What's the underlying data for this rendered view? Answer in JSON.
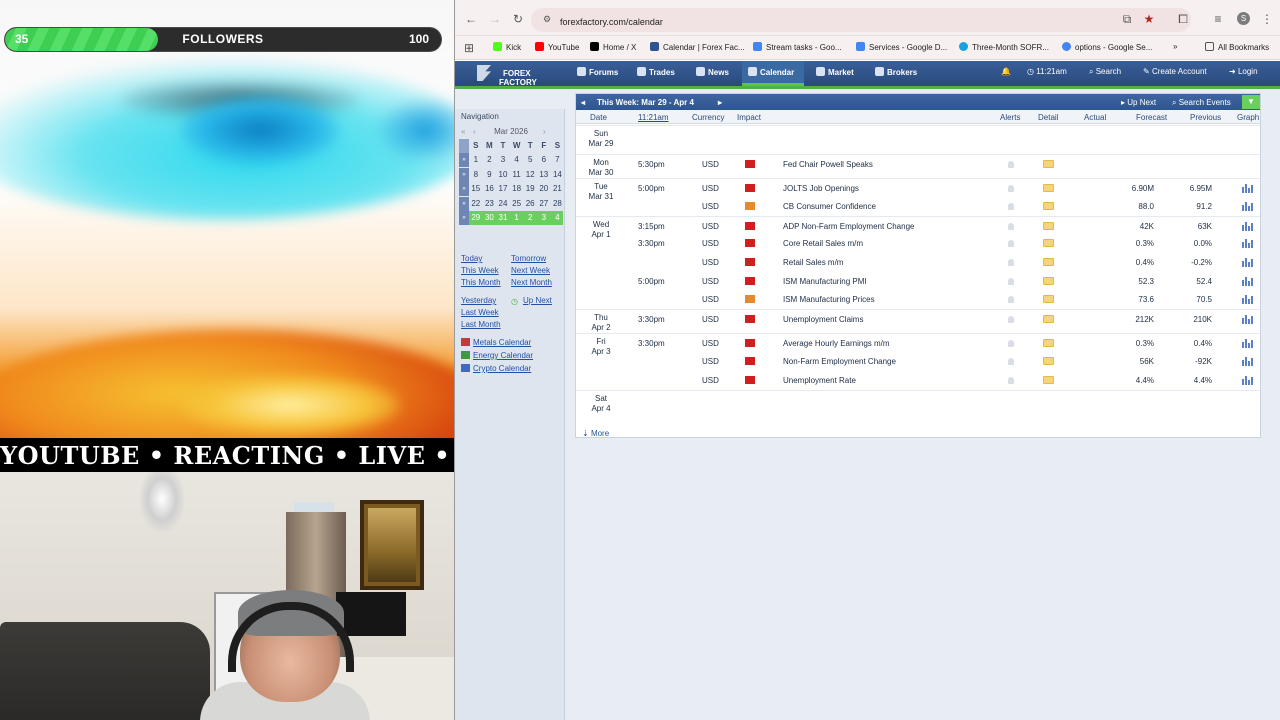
{
  "stream": {
    "followers": {
      "current": "35",
      "label": "FOLLOWERS",
      "goal": "100",
      "progress": 0.35
    },
    "ticker": "YOUTUBE • REACTING • LIVE • NI"
  },
  "browser": {
    "url": "forexfactory.com/calendar",
    "bookmarks": [
      {
        "label": "Kick",
        "color": "#53fc18"
      },
      {
        "label": "YouTube",
        "color": "#ff0000"
      },
      {
        "label": "Home / X",
        "color": "#000000"
      },
      {
        "label": "Calendar | Forex Fac...",
        "color": "#2e5590"
      },
      {
        "label": "Stream tasks - Goo...",
        "color": "#4285f4"
      },
      {
        "label": "Services - Google D...",
        "color": "#4285f4"
      },
      {
        "label": "Three-Month SOFR...",
        "color": "#1aa0e0"
      },
      {
        "label": "options - Google Se...",
        "color": "#4285f4"
      }
    ],
    "all_bookmarks": "All Bookmarks"
  },
  "ff": {
    "logo_line1": "FOREX",
    "logo_line2": "FACTORY",
    "nav": [
      "Forums",
      "Trades",
      "News",
      "Calendar",
      "Market",
      "Brokers"
    ],
    "time": "11:21am",
    "search": "Search",
    "create_account": "Create Account",
    "login": "Login",
    "sidebar": {
      "title": "Navigation",
      "month": "Mar 2026",
      "weekdays": [
        "S",
        "M",
        "T",
        "W",
        "T",
        "F",
        "S"
      ],
      "weeks": [
        [
          "1",
          "2",
          "3",
          "4",
          "5",
          "6",
          "7"
        ],
        [
          "8",
          "9",
          "10",
          "11",
          "12",
          "13",
          "14"
        ],
        [
          "15",
          "16",
          "17",
          "18",
          "19",
          "20",
          "21"
        ],
        [
          "22",
          "23",
          "24",
          "25",
          "26",
          "27",
          "28"
        ],
        [
          "29",
          "30",
          "31",
          "1",
          "2",
          "3",
          "4"
        ]
      ],
      "links": {
        "today": "Today",
        "tomorrow": "Tomorrow",
        "this_week": "This Week",
        "next_week": "Next Week",
        "this_month": "This Month",
        "next_month": "Next Month",
        "yesterday": "Yesterday",
        "up_next": "Up Next",
        "last_week": "Last Week",
        "last_month": "Last Month",
        "metals": "Metals Calendar",
        "energy": "Energy Calendar",
        "crypto": "Crypto Calendar"
      }
    },
    "calendar": {
      "week_title": "This Week: Mar 29 - Apr 4",
      "up_next": "Up Next",
      "search_events": "Search Events",
      "headers": {
        "date": "Date",
        "time": "11:21am",
        "currency": "Currency",
        "impact": "Impact",
        "alerts": "Alerts",
        "detail": "Detail",
        "actual": "Actual",
        "forecast": "Forecast",
        "previous": "Previous",
        "graph": "Graph"
      },
      "rows": [
        {
          "day": "Sun",
          "date": "Mar 29",
          "time": "",
          "currency": "",
          "impact": "",
          "event": "",
          "forecast": "",
          "previous": ""
        },
        {
          "day": "Mon",
          "date": "Mar 30",
          "time": "5:30pm",
          "currency": "USD",
          "impact": "high",
          "event": "Fed Chair Powell Speaks",
          "forecast": "",
          "previous": ""
        },
        {
          "day": "Tue",
          "date": "Mar 31",
          "time": "5:00pm",
          "currency": "USD",
          "impact": "high",
          "event": "JOLTS Job Openings",
          "forecast": "6.90M",
          "previous": "6.95M"
        },
        {
          "day": "",
          "date": "",
          "time": "",
          "currency": "USD",
          "impact": "medium",
          "event": "CB Consumer Confidence",
          "forecast": "88.0",
          "previous": "91.2"
        },
        {
          "day": "Wed",
          "date": "Apr 1",
          "time": "3:15pm",
          "currency": "USD",
          "impact": "high",
          "event": "ADP Non-Farm Employment Change",
          "forecast": "42K",
          "previous": "63K"
        },
        {
          "day": "",
          "date": "",
          "time": "3:30pm",
          "currency": "USD",
          "impact": "high",
          "event": "Core Retail Sales m/m",
          "forecast": "0.3%",
          "previous": "0.0%"
        },
        {
          "day": "",
          "date": "",
          "time": "",
          "currency": "USD",
          "impact": "high",
          "event": "Retail Sales m/m",
          "forecast": "0.4%",
          "previous": "-0.2%"
        },
        {
          "day": "",
          "date": "",
          "time": "5:00pm",
          "currency": "USD",
          "impact": "high",
          "event": "ISM Manufacturing PMI",
          "forecast": "52.3",
          "previous": "52.4"
        },
        {
          "day": "",
          "date": "",
          "time": "",
          "currency": "USD",
          "impact": "medium",
          "event": "ISM Manufacturing Prices",
          "forecast": "73.6",
          "previous": "70.5"
        },
        {
          "day": "Thu",
          "date": "Apr 2",
          "time": "3:30pm",
          "currency": "USD",
          "impact": "high",
          "event": "Unemployment Claims",
          "forecast": "212K",
          "previous": "210K"
        },
        {
          "day": "Fri",
          "date": "Apr 3",
          "time": "3:30pm",
          "currency": "USD",
          "impact": "high",
          "event": "Average Hourly Earnings m/m",
          "forecast": "0.3%",
          "previous": "0.4%"
        },
        {
          "day": "",
          "date": "",
          "time": "",
          "currency": "USD",
          "impact": "high",
          "event": "Non-Farm Employment Change",
          "forecast": "56K",
          "previous": "-92K"
        },
        {
          "day": "",
          "date": "",
          "time": "",
          "currency": "USD",
          "impact": "high",
          "event": "Unemployment Rate",
          "forecast": "4.4%",
          "previous": "4.4%"
        },
        {
          "day": "Sat",
          "date": "Apr 4",
          "time": "",
          "currency": "",
          "impact": "",
          "event": "",
          "forecast": "",
          "previous": ""
        }
      ],
      "more": "More"
    }
  }
}
